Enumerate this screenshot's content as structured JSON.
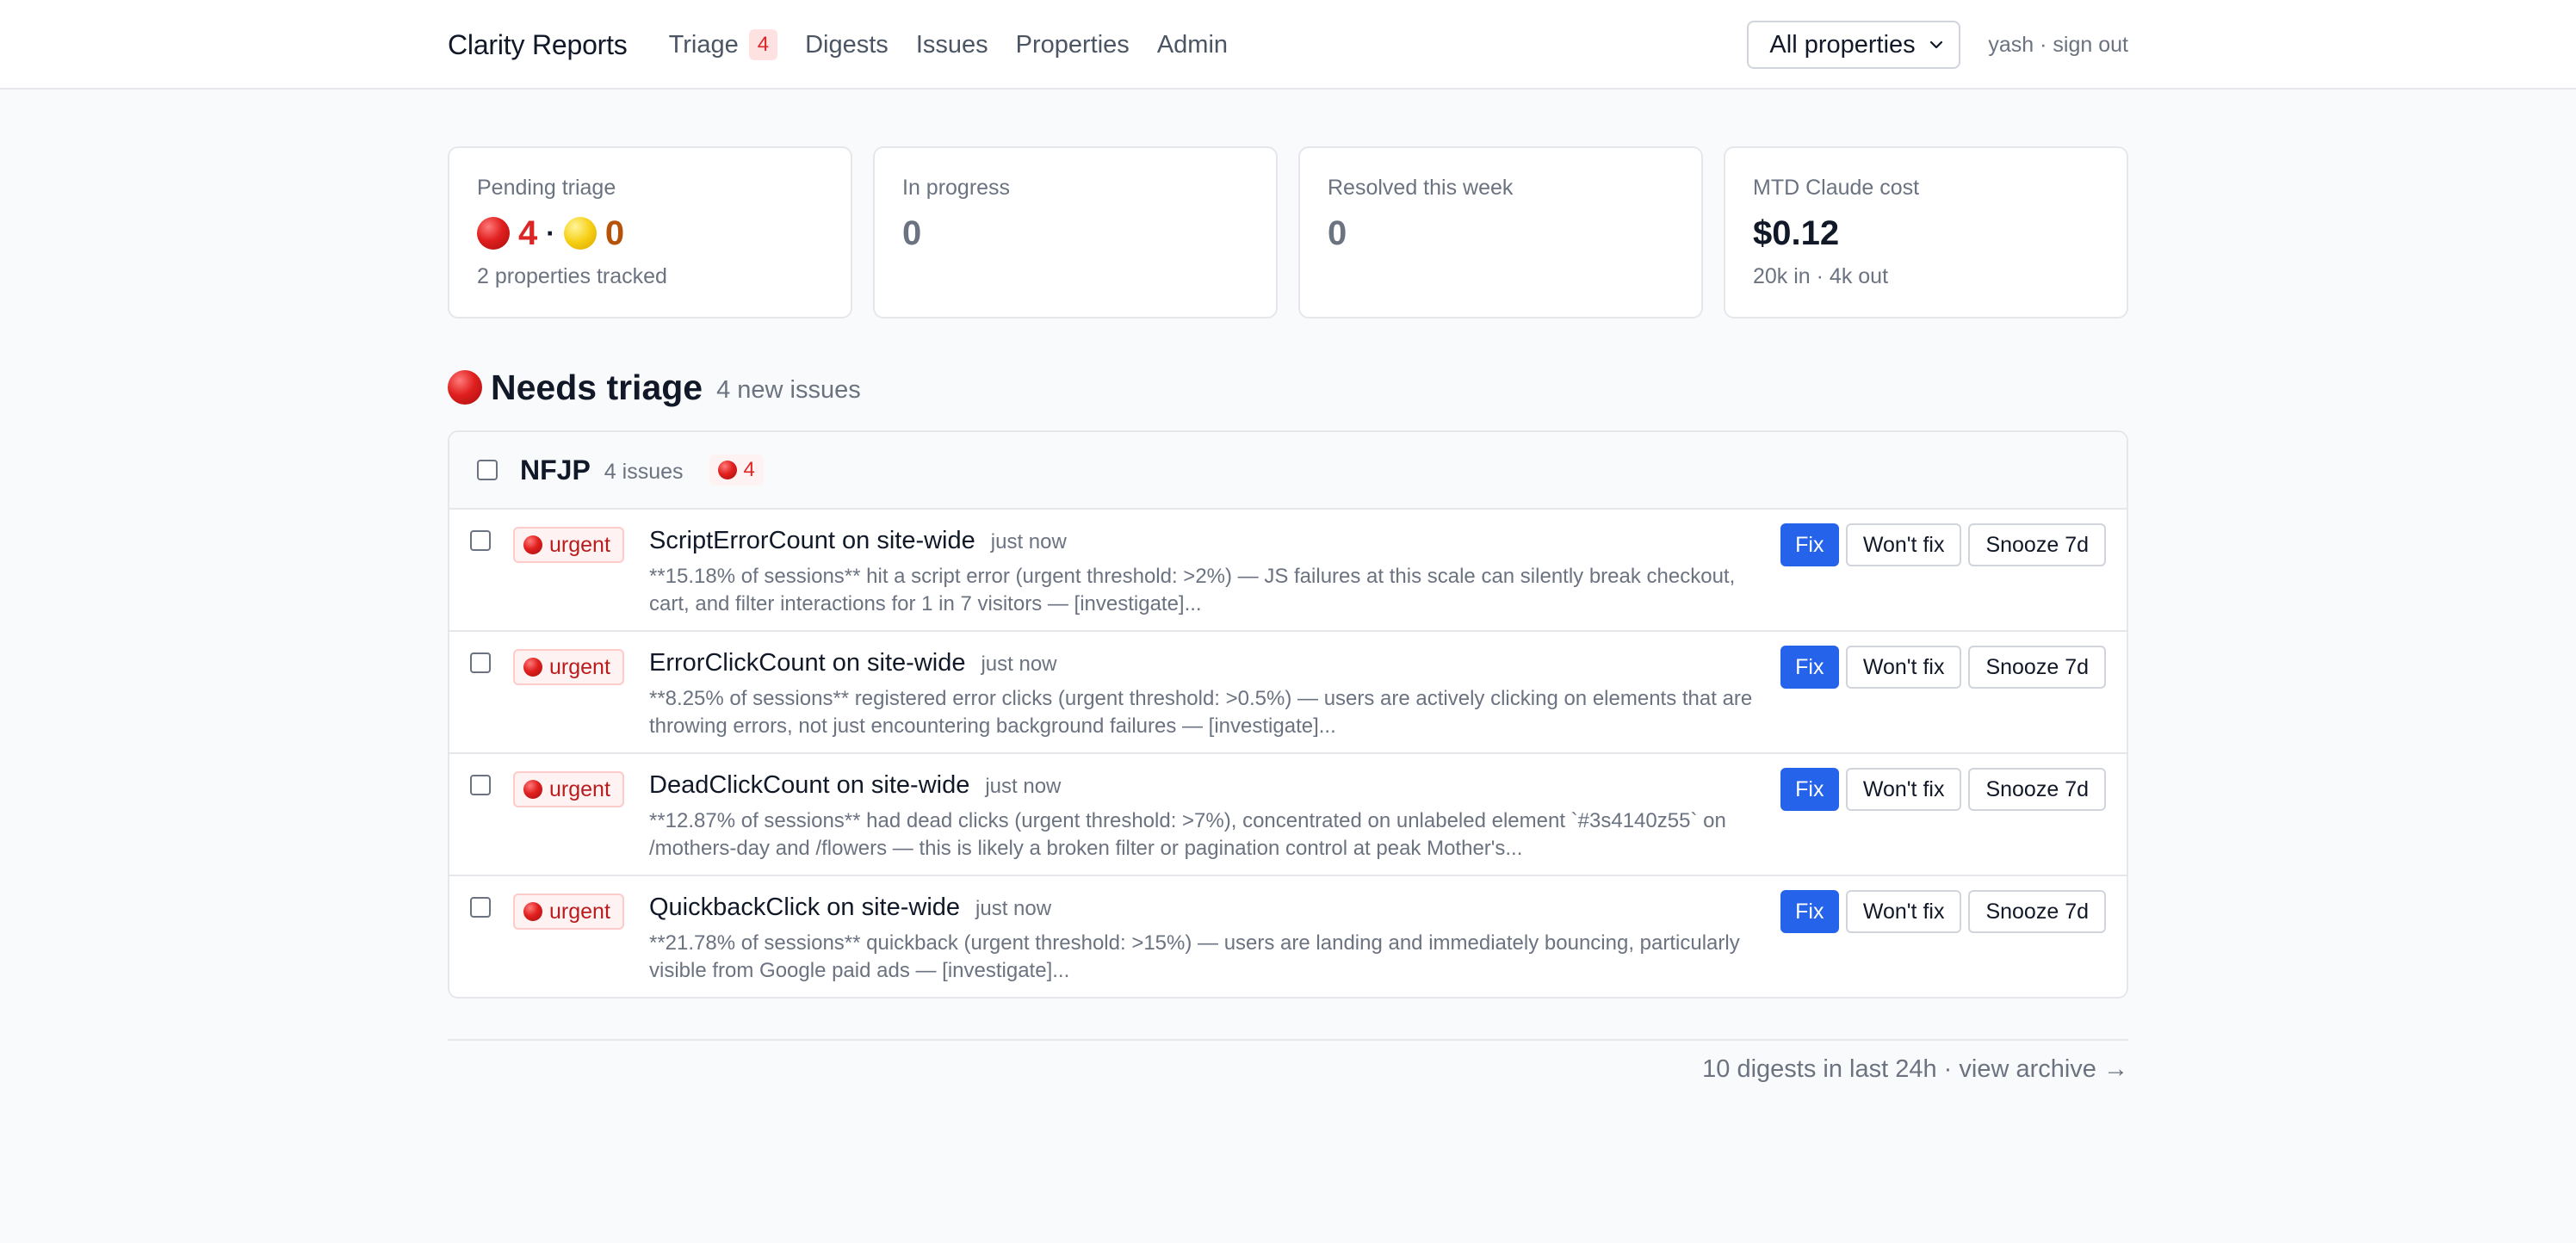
{
  "header": {
    "brand": "Clarity Reports",
    "nav": [
      {
        "label": "Triage",
        "badge": "4"
      },
      {
        "label": "Digests"
      },
      {
        "label": "Issues"
      },
      {
        "label": "Properties"
      },
      {
        "label": "Admin"
      }
    ],
    "property_select": "All properties",
    "user_links": "yash · sign out"
  },
  "stats": {
    "pending": {
      "label": "Pending triage",
      "red_count": "4",
      "separator": "·",
      "yellow_count": "0",
      "sub": "2 properties tracked"
    },
    "in_progress": {
      "label": "In progress",
      "value": "0"
    },
    "resolved": {
      "label": "Resolved this week",
      "value": "0"
    },
    "cost": {
      "label": "MTD Claude cost",
      "value": "$0.12",
      "sub": "20k in · 4k out"
    }
  },
  "section": {
    "title": "Needs triage",
    "count": "4 new issues"
  },
  "group": {
    "name": "NFJP",
    "count": "4 issues",
    "badge": "4",
    "issues": [
      {
        "severity": "urgent",
        "title": "ScriptErrorCount on site-wide",
        "time": "just now",
        "desc": "**15.18% of sessions** hit a script error (urgent threshold: >2%) — JS failures at this scale can silently break checkout, cart, and filter interactions for 1 in 7 visitors — [investigate]..."
      },
      {
        "severity": "urgent",
        "title": "ErrorClickCount on site-wide",
        "time": "just now",
        "desc": "**8.25% of sessions** registered error clicks (urgent threshold: >0.5%) — users are actively clicking on elements that are throwing errors, not just encountering background failures — [investigate]..."
      },
      {
        "severity": "urgent",
        "title": "DeadClickCount on site-wide",
        "time": "just now",
        "desc": "**12.87% of sessions** had dead clicks (urgent threshold: >7%), concentrated on unlabeled element `#3s4140z55` on /mothers-day and /flowers — this is likely a broken filter or pagination control at peak Mother's..."
      },
      {
        "severity": "urgent",
        "title": "QuickbackClick on site-wide",
        "time": "just now",
        "desc": "**21.78% of sessions** quickback (urgent threshold: >15%) — users are landing and immediately bouncing, particularly visible from Google paid ads — [investigate]..."
      }
    ],
    "actions": {
      "fix": "Fix",
      "wont_fix": "Won't fix",
      "snooze": "Snooze 7d"
    }
  },
  "footer": {
    "text": "10 digests in last 24h · view archive →"
  }
}
